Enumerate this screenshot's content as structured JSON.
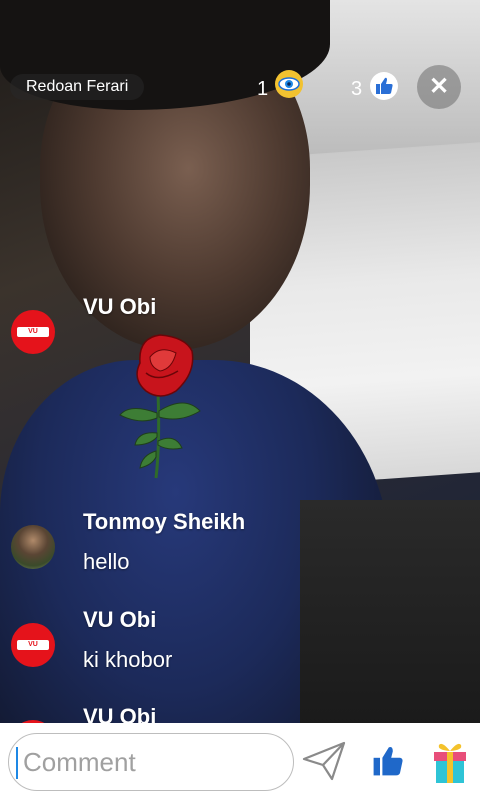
{
  "host": {
    "name": "Redoan Ferari"
  },
  "stats": {
    "viewers": "1",
    "likes": "3"
  },
  "icons": {
    "viewers": "eye-icon",
    "likes": "thumbs-up-icon",
    "close": "close-icon",
    "send": "send-icon",
    "like": "thumbs-up-icon",
    "gift": "gift-icon"
  },
  "close_glyph": "✕",
  "chat": [
    {
      "user": "VU Obi",
      "message": "",
      "sticker": "rose"
    },
    {
      "user": "Tonmoy Sheikh",
      "message": "hello"
    },
    {
      "user": "VU Obi",
      "message": "ki khobor"
    },
    {
      "user": "VU Obi",
      "message": ""
    }
  ],
  "comment": {
    "placeholder": "Comment"
  },
  "colors": {
    "accent": "#1e88e5",
    "brand": "#e5131b",
    "eye": "#f2c230"
  }
}
